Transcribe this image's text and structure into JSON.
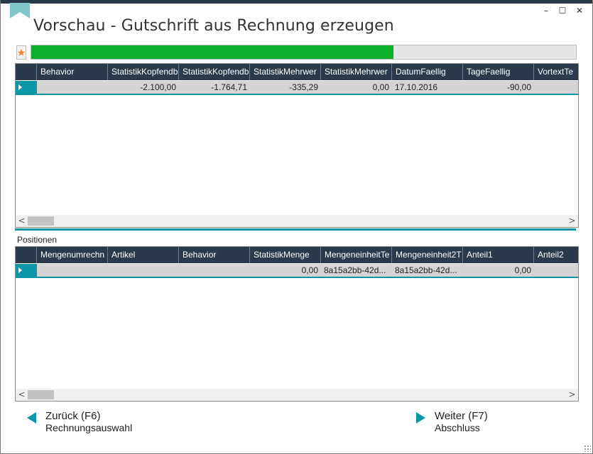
{
  "window": {
    "title": "Vorschau - Gutschrift aus Rechnung erzeugen",
    "controls": {
      "minimize": "–",
      "maximize": "☐",
      "close": "✕"
    }
  },
  "progress": {
    "percent": 66.5
  },
  "colors": {
    "accent": "#0d97a5",
    "header_bg": "#2b3a4a",
    "progress": "#0db02b",
    "row_selected": "#d4d4d4"
  },
  "grid_top": {
    "columns": [
      "Behavior",
      "StatistikKopfendb",
      "StatistikKopfendb",
      "StatistikMehrwer",
      "StatistikMehrwer",
      "DatumFaellig",
      "TageFaellig",
      "VortextTe"
    ],
    "rows": [
      {
        "cells": [
          "",
          "-2.100,00",
          "-1.764,71",
          "-335,29",
          "0,00",
          "17.10.2016",
          "-90,00",
          ""
        ]
      }
    ]
  },
  "positions_label": "Positionen",
  "grid_bottom": {
    "columns": [
      "Mengenumrechn",
      "Artikel",
      "Behavior",
      "StatistikMenge",
      "MengeneinheitTe",
      "Mengeneinheit2T",
      "Anteil1",
      "Anteil2"
    ],
    "rows": [
      {
        "cells": [
          "",
          "",
          "",
          "0,00",
          "8a15a2bb-42d...",
          "8a15a2bb-42d...",
          "0,00",
          ""
        ]
      }
    ]
  },
  "scroll": {
    "left": "<",
    "right": ">"
  },
  "nav": {
    "back": {
      "label": "Zurück (F6)",
      "sub": "Rechnungsauswahl"
    },
    "next": {
      "label": "Weiter (F7)",
      "sub": "Abschluss"
    }
  }
}
